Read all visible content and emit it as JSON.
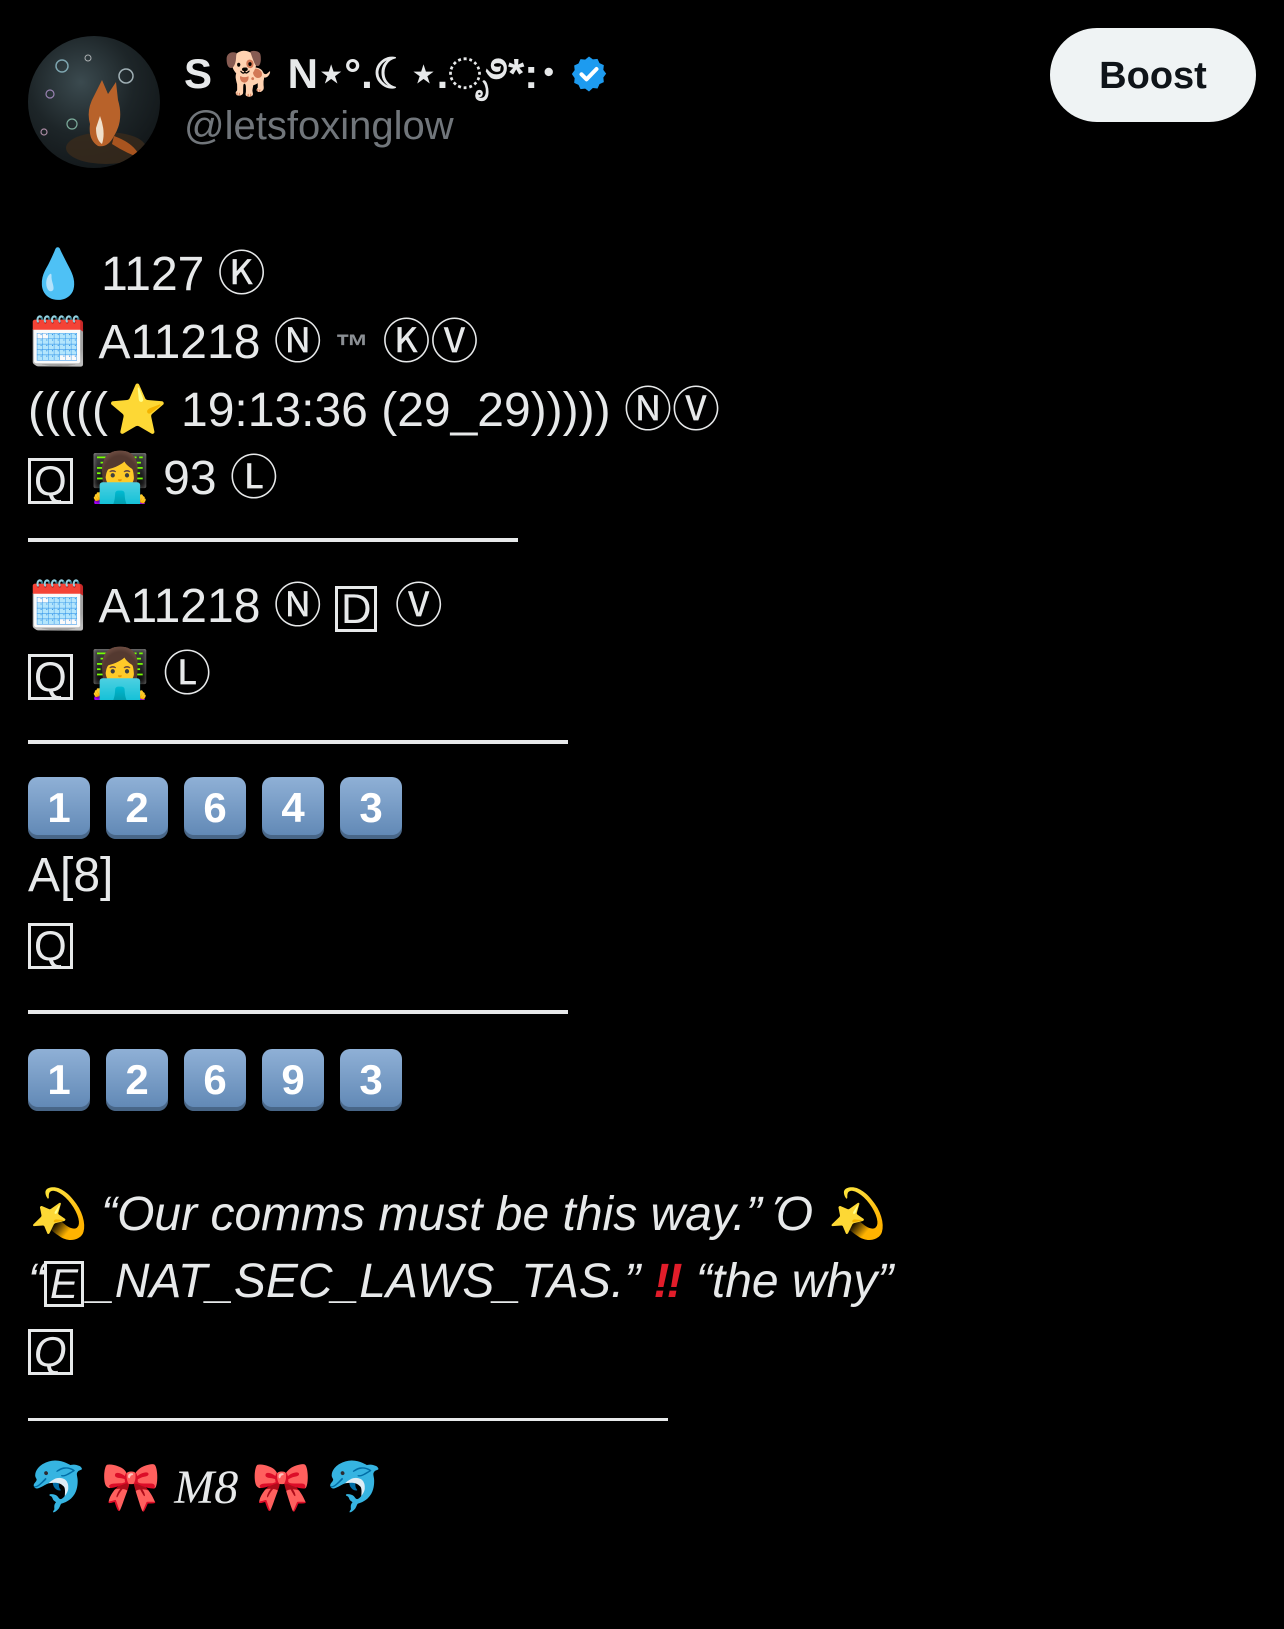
{
  "header": {
    "display_name": "S 🐕 N⋆°.☾⋆.ೃ࿔*:･",
    "handle": "@letsfoxinglow",
    "boost_label": "Boost",
    "verified_color": "#1d9bf0"
  },
  "post": {
    "l1_emoji": "💧",
    "l1_text": "1127",
    "l1_circ": "Ⓚ",
    "l2_emoji": "🗓️",
    "l2_text": "A11218",
    "l2_circ1": "Ⓝ",
    "l2_tm": "™",
    "l2_circ2": "ⓀⓋ",
    "l3_prefix": "(((((",
    "l3_emoji": "⭐",
    "l3_text": "19:13:36 (29_29)))))",
    "l3_circ": "ⓃⓋ",
    "l4_box": "Q",
    "l4_emoji": "👩‍💻",
    "l4_text": "93",
    "l4_circ": "Ⓛ",
    "l5_emoji": "🗓️",
    "l5_text": "A11218",
    "l5_circ1": "Ⓝ",
    "l5_box": "D",
    "l5_circ2": "Ⓥ",
    "l6_box": "Q",
    "l6_emoji": "👩‍💻",
    "l6_circ": "Ⓛ",
    "keycaps_1": [
      "1",
      "2",
      "6",
      "4",
      "3"
    ],
    "l8_text": "A[8]",
    "l9_box": "Q",
    "keycaps_2": [
      "1",
      "2",
      "6",
      "9",
      "3"
    ],
    "q1_emoji": "💫",
    "q1_text": "“Our comms must be this way.” Ό",
    "q2_open": "“",
    "q2_box": "E",
    "q2_text": "_NAT_SEC_LAWS_TAS.”",
    "q2_excl": "‼",
    "q2_tail": "“the why”",
    "q3_box": "Q",
    "dolphin": "🐬",
    "bow": "🎀",
    "m8": "M8"
  }
}
